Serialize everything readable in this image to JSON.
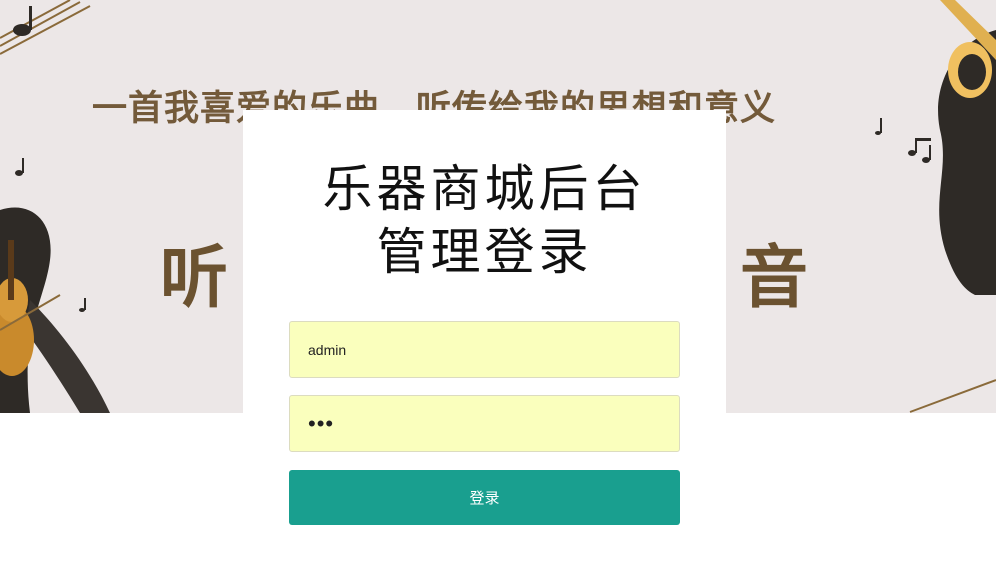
{
  "banner": {
    "slogan": "一首我喜爱的乐曲，听传给我的思想和意义",
    "big_left": "听",
    "big_right": "音"
  },
  "login": {
    "title_line1": "乐器商城后台",
    "title_line2": "管理登录",
    "username_value": "admin",
    "password_value": "•••",
    "button_label": "登录"
  },
  "colors": {
    "button": "#199f8f",
    "field_background": "#faffbd",
    "banner_background": "#ece7e7",
    "banner_text": "#735a3a"
  }
}
